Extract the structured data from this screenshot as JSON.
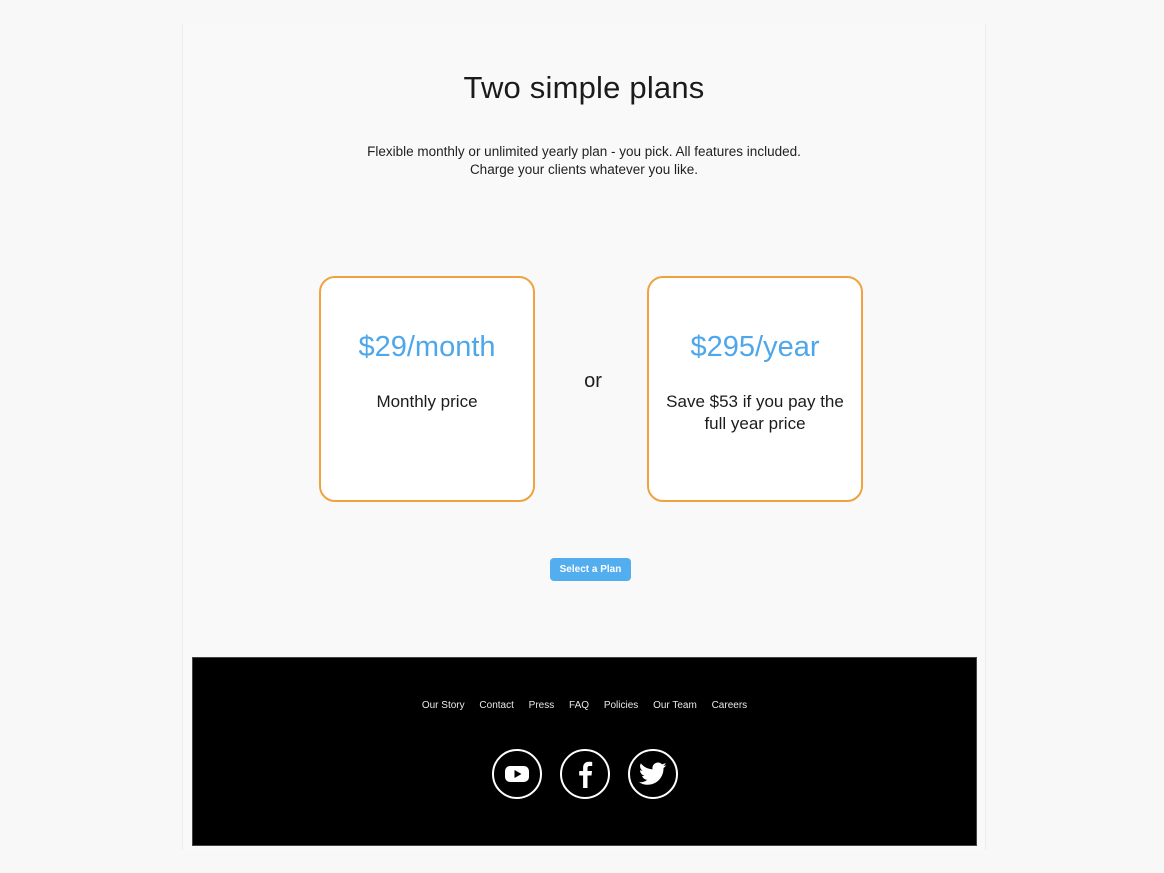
{
  "header": {
    "title": "Two simple plans",
    "subtitle_line1": "Flexible monthly or unlimited yearly plan - you pick. All features included.",
    "subtitle_line2": "Charge your clients whatever you like."
  },
  "plans": [
    {
      "price": "$29/month",
      "description": "Monthly price"
    },
    {
      "price": "$295/year",
      "description": "Save $53 if you pay the full year price"
    }
  ],
  "separator": "or",
  "cta": {
    "label": "Select a Plan"
  },
  "footer": {
    "links": [
      "Our Story",
      "Contact",
      "Press",
      "FAQ",
      "Policies",
      "Our Team",
      "Careers"
    ],
    "social": [
      "youtube-icon",
      "facebook-icon",
      "twitter-icon"
    ]
  },
  "colors": {
    "accent_blue": "#4ea7ea",
    "card_border": "#efa23f",
    "button": "#53aef0",
    "footer_bg": "#000000"
  }
}
